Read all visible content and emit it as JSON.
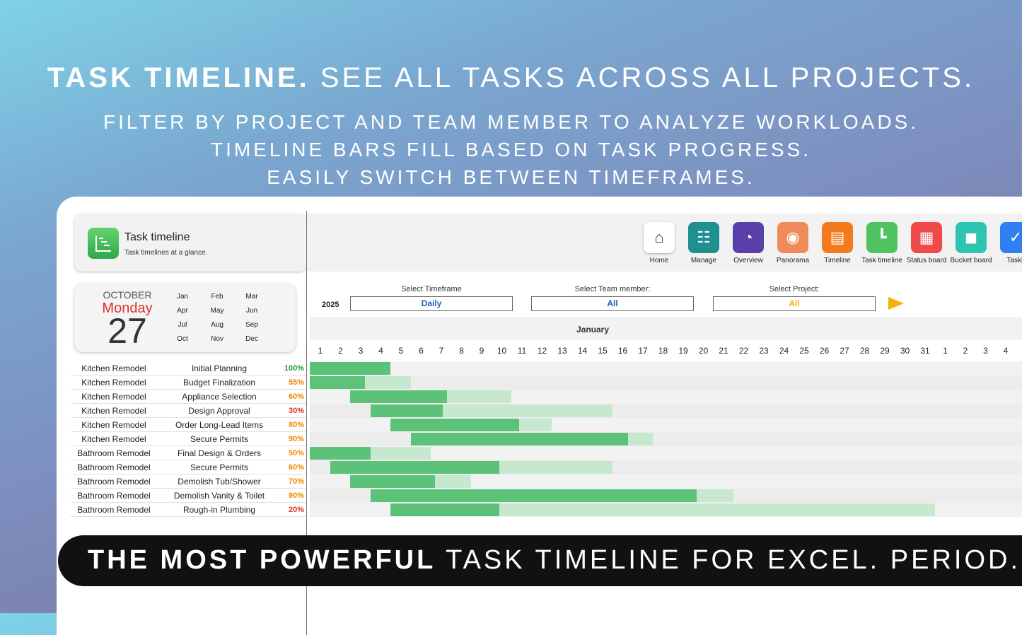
{
  "hero": {
    "line1_bold": "TASK TIMELINE.",
    "line1_rest": " SEE ALL TASKS ACROSS ALL PROJECTS.",
    "line2": "FILTER BY PROJECT AND TEAM MEMBER TO ANALYZE WORKLOADS.",
    "line3": "TIMELINE BARS FILL BASED ON TASK PROGRESS.",
    "line4": "EASILY SWITCH BETWEEN TIMEFRAMES."
  },
  "header": {
    "title": "Task timeline",
    "subtitle": "Task timelines at a glance."
  },
  "nav": [
    {
      "label": "Home",
      "icon": "house-icon",
      "color": "#ffffff"
    },
    {
      "label": "Manage",
      "icon": "org-chart-icon",
      "color": "#1f8f8f"
    },
    {
      "label": "Overview",
      "icon": "speedometer-icon",
      "color": "#5a3fa8"
    },
    {
      "label": "Panorama",
      "icon": "eye-icon",
      "color": "#f08a5a"
    },
    {
      "label": "Timeline",
      "icon": "timeline-icon",
      "color": "#f47a1e"
    },
    {
      "label": "Task timeline",
      "icon": "task-timeline-icon",
      "color": "#4fc35f"
    },
    {
      "label": "Status board",
      "icon": "status-board-icon",
      "color": "#ef4a4a"
    },
    {
      "label": "Bucket board",
      "icon": "bucket-icon",
      "color": "#2fc4b2"
    },
    {
      "label": "Taskli",
      "icon": "tasklist-icon",
      "color": "#2f7ff0"
    }
  ],
  "date": {
    "month": "OCTOBER",
    "weekday": "Monday",
    "day": "27"
  },
  "months": [
    "Jan",
    "Feb",
    "Mar",
    "Apr",
    "May",
    "Jun",
    "Jul",
    "Aug",
    "Sep",
    "Oct",
    "Nov",
    "Dec"
  ],
  "filters": {
    "year": "2025",
    "timeframe_label": "Select Timeframe",
    "timeframe_value": "Daily",
    "member_label": "Select Team member:",
    "member_value": "All",
    "project_label": "Select Project:",
    "project_value": "All"
  },
  "timeline": {
    "month_label": "January",
    "days": [
      "1",
      "2",
      "3",
      "4",
      "5",
      "6",
      "7",
      "8",
      "9",
      "10",
      "11",
      "12",
      "13",
      "14",
      "15",
      "16",
      "17",
      "18",
      "19",
      "20",
      "21",
      "22",
      "23",
      "24",
      "25",
      "26",
      "27",
      "28",
      "29",
      "30",
      "31",
      "1",
      "2",
      "3",
      "4"
    ]
  },
  "tasks": [
    {
      "project": "Kitchen Remodel",
      "task": "Initial Planning",
      "progress": "100%",
      "pct": 1.0,
      "start": 1,
      "end": 4,
      "pct_color": "#1e9e3e"
    },
    {
      "project": "Kitchen Remodel",
      "task": "Budget Finalization",
      "progress": "55%",
      "pct": 0.55,
      "start": 1,
      "end": 5,
      "pct_color": "#f08a00"
    },
    {
      "project": "Kitchen Remodel",
      "task": "Appliance Selection",
      "progress": "60%",
      "pct": 0.6,
      "start": 3,
      "end": 10,
      "pct_color": "#f08a00"
    },
    {
      "project": "Kitchen Remodel",
      "task": "Design Approval",
      "progress": "30%",
      "pct": 0.3,
      "start": 4,
      "end": 15,
      "pct_color": "#e03030"
    },
    {
      "project": "Kitchen Remodel",
      "task": "Order Long-Lead Items",
      "progress": "80%",
      "pct": 0.8,
      "start": 5,
      "end": 12,
      "pct_color": "#f08a00"
    },
    {
      "project": "Kitchen Remodel",
      "task": "Secure Permits",
      "progress": "90%",
      "pct": 0.9,
      "start": 6,
      "end": 17,
      "pct_color": "#f08a00"
    },
    {
      "project": "Bathroom Remodel",
      "task": "Final Design & Orders",
      "progress": "50%",
      "pct": 0.5,
      "start": 1,
      "end": 6,
      "pct_color": "#f08a00"
    },
    {
      "project": "Bathroom Remodel",
      "task": "Secure Permits",
      "progress": "60%",
      "pct": 0.6,
      "start": 2,
      "end": 15,
      "pct_color": "#f08a00"
    },
    {
      "project": "Bathroom Remodel",
      "task": "Demolish Tub/Shower",
      "progress": "70%",
      "pct": 0.7,
      "start": 3,
      "end": 8,
      "pct_color": "#f08a00"
    },
    {
      "project": "Bathroom Remodel",
      "task": "Demolish Vanity & Toilet",
      "progress": "90%",
      "pct": 0.9,
      "start": 4,
      "end": 21,
      "pct_color": "#f08a00"
    },
    {
      "project": "Bathroom Remodel",
      "task": "Rough-in Plumbing",
      "progress": "20%",
      "pct": 0.2,
      "start": 5,
      "end": 31,
      "pct_color": "#e03030"
    }
  ],
  "banner": {
    "bold": "THE MOST POWERFUL",
    "rest": " TASK TIMELINE FOR EXCEL. PERIOD."
  }
}
